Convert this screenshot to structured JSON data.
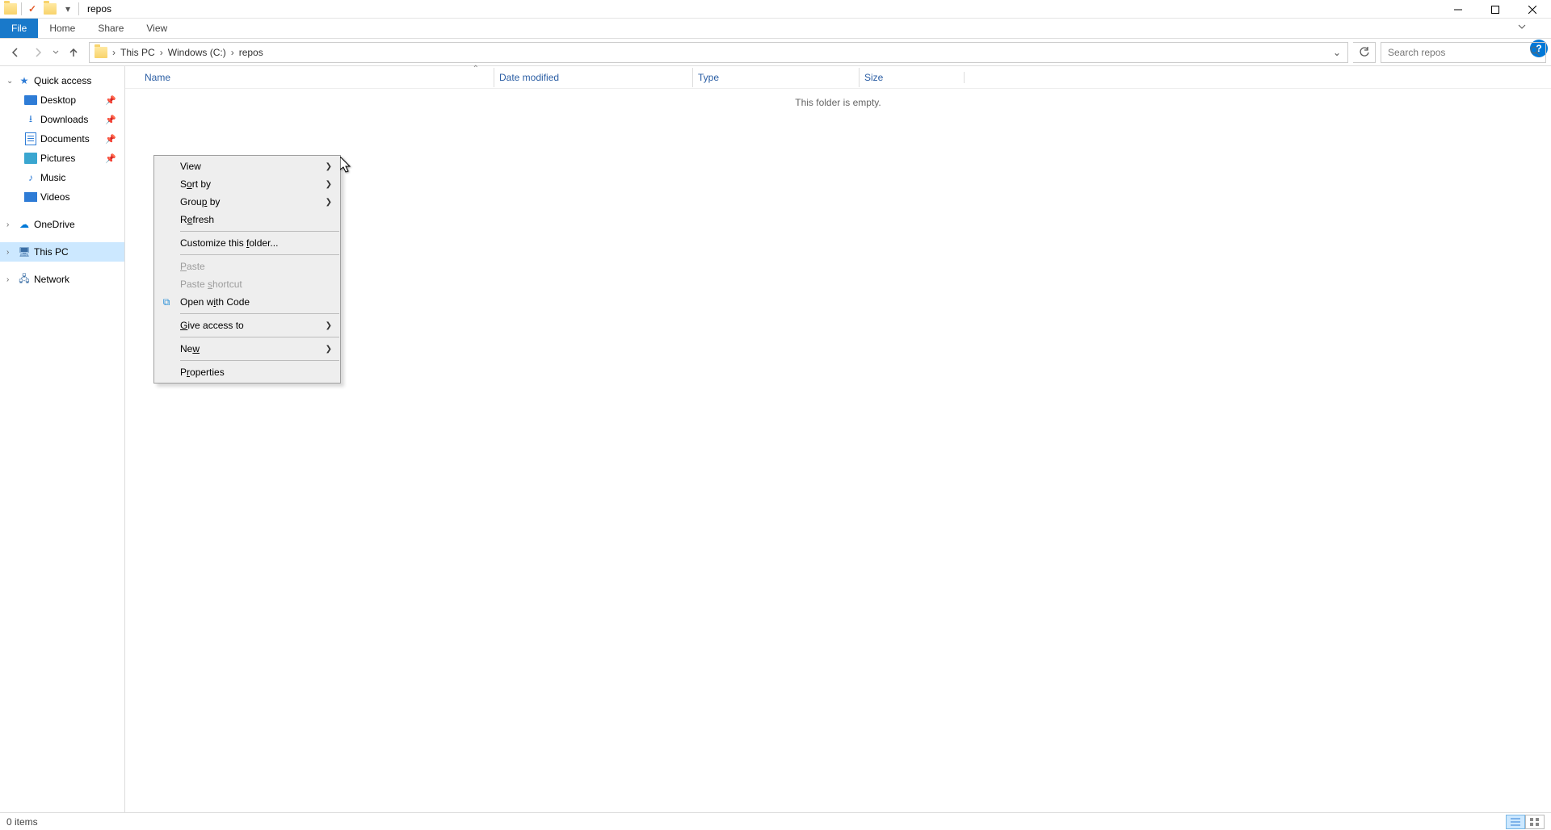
{
  "titlebar": {
    "title": "repos"
  },
  "ribbon": {
    "file": "File",
    "home": "Home",
    "share": "Share",
    "view": "View"
  },
  "breadcrumb": {
    "segments": [
      "This PC",
      "Windows (C:)",
      "repos"
    ]
  },
  "search": {
    "placeholder": "Search repos"
  },
  "tree": {
    "quick_access": "Quick access",
    "desktop": "Desktop",
    "downloads": "Downloads",
    "documents": "Documents",
    "pictures": "Pictures",
    "music": "Music",
    "videos": "Videos",
    "onedrive": "OneDrive",
    "this_pc": "This PC",
    "network": "Network"
  },
  "columns": {
    "name": "Name",
    "date": "Date modified",
    "type": "Type",
    "size": "Size"
  },
  "empty_message": "This folder is empty.",
  "context_menu": {
    "view": "View",
    "sort_by": "Sort by",
    "group_by": "Group by",
    "refresh": "Refresh",
    "customize": "Customize this folder...",
    "paste": "Paste",
    "paste_shortcut": "Paste shortcut",
    "open_with_code": "Open with Code",
    "give_access": "Give access to",
    "new": "New",
    "properties": "Properties"
  },
  "status": {
    "items": "0 items"
  }
}
